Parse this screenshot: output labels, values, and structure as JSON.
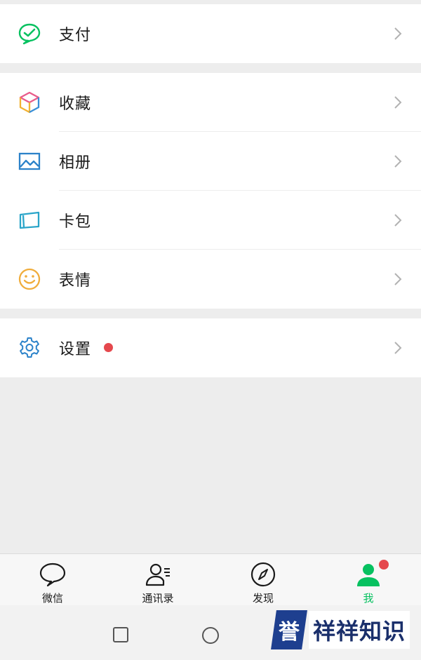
{
  "menu": {
    "pay": {
      "label": "支付",
      "icon": "pay-check-icon"
    },
    "favorites": {
      "label": "收藏",
      "icon": "cube-icon"
    },
    "album": {
      "label": "相册",
      "icon": "picture-icon"
    },
    "cards": {
      "label": "卡包",
      "icon": "card-icon"
    },
    "stickers": {
      "label": "表情",
      "icon": "smiley-icon"
    },
    "settings": {
      "label": "设置",
      "icon": "gear-icon",
      "has_badge": true
    }
  },
  "tabbar": {
    "chats": {
      "label": "微信",
      "icon": "chat-bubble-icon"
    },
    "contacts": {
      "label": "通讯录",
      "icon": "contacts-icon"
    },
    "discover": {
      "label": "发现",
      "icon": "compass-icon"
    },
    "me": {
      "label": "我",
      "icon": "person-icon",
      "active": true,
      "has_badge": true
    }
  },
  "colors": {
    "accent_green": "#07c160",
    "badge_red": "#e5484d",
    "background": "#ededed"
  },
  "watermark": {
    "badge": "誉",
    "text": "祥祥知识"
  }
}
